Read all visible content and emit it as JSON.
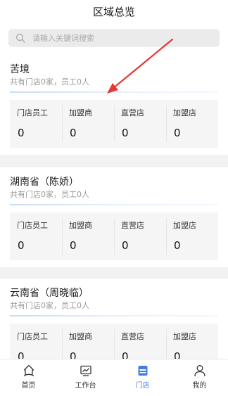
{
  "header": {
    "title": "区域总览",
    "search_placeholder": "请输入关键词搜索"
  },
  "regions": [
    {
      "name": "苦境",
      "summary": "共有门店0家，员工0人",
      "stats": [
        {
          "label": "门店员工",
          "value": "0"
        },
        {
          "label": "加盟商",
          "value": "0"
        },
        {
          "label": "直营店",
          "value": "0"
        },
        {
          "label": "加盟店",
          "value": "0"
        }
      ]
    },
    {
      "name": "湖南省（陈娇）",
      "summary": "共有门店0家，员工0人",
      "stats": [
        {
          "label": "门店员工",
          "value": "0"
        },
        {
          "label": "加盟商",
          "value": "0"
        },
        {
          "label": "直营店",
          "value": "0"
        },
        {
          "label": "加盟店",
          "value": "0"
        }
      ]
    },
    {
      "name": "云南省（周晓临）",
      "summary": "共有门店0家，员工0人",
      "stats": [
        {
          "label": "门店员工",
          "value": "0"
        },
        {
          "label": "加盟商",
          "value": "0"
        },
        {
          "label": "直营店",
          "value": "0"
        },
        {
          "label": "加盟店",
          "value": "0"
        }
      ]
    }
  ],
  "tabbar": {
    "items": [
      {
        "label": "首页",
        "icon": "home-icon"
      },
      {
        "label": "工作台",
        "icon": "workbench-icon"
      },
      {
        "label": "门店",
        "icon": "store-icon"
      },
      {
        "label": "我的",
        "icon": "profile-icon"
      }
    ],
    "active_index": 2,
    "active_color": "#3f7fe0"
  },
  "annotation": {
    "color": "#e53935"
  }
}
